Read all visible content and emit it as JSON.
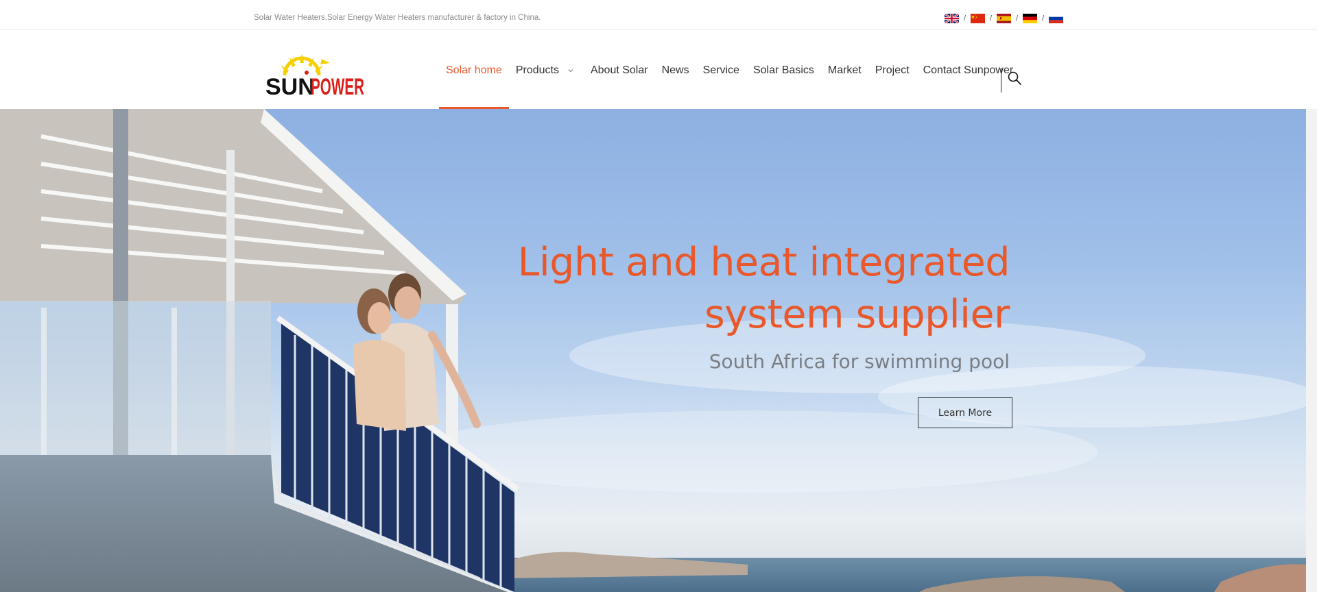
{
  "topbar": {
    "tagline": "Solar Water Heaters,Solar Energy Water Heaters manufacturer & factory in China.",
    "separator": "/",
    "languages": [
      {
        "icon": "uk-flag-icon",
        "name": "English"
      },
      {
        "icon": "china-flag-icon",
        "name": "Chinese"
      },
      {
        "icon": "spain-flag-icon",
        "name": "Spanish"
      },
      {
        "icon": "germany-flag-icon",
        "name": "German"
      },
      {
        "icon": "russia-flag-icon",
        "name": "Russian"
      }
    ]
  },
  "header": {
    "logo": {
      "text_part1": "SUN",
      "text_part2": "POWER",
      "icon": "sun-logo-icon"
    },
    "nav": [
      {
        "label": "Solar home",
        "active": true
      },
      {
        "label": "Products",
        "has_dropdown": true
      },
      {
        "label": "About Solar"
      },
      {
        "label": "News"
      },
      {
        "label": "Service"
      },
      {
        "label": "Solar Basics"
      },
      {
        "label": "Market"
      },
      {
        "label": "Project"
      },
      {
        "label": "Contact Sunpower"
      }
    ],
    "search_icon": "search-icon"
  },
  "hero": {
    "headline_line1": "Light and heat integrated",
    "headline_line2": "system supplier",
    "subtitle": "South Africa for swimming pool",
    "button_label": "Learn More"
  },
  "colors": {
    "accent": "#e8582a",
    "logo_yellow": "#f5d000",
    "logo_red": "#d9201a",
    "text_dark": "#333333",
    "text_muted": "#7a7e84"
  }
}
